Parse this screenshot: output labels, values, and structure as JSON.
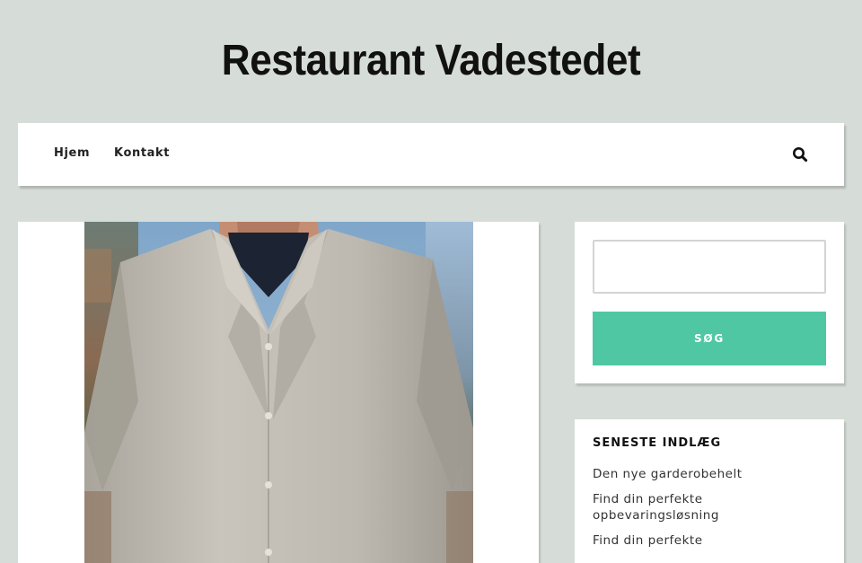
{
  "site": {
    "title": "Restaurant Vadestedet"
  },
  "nav": {
    "items": [
      {
        "label": "Hjem"
      },
      {
        "label": "Kontakt"
      }
    ],
    "search_icon": "search-icon"
  },
  "main": {
    "featured_image": {
      "subject": "man wearing a light grey short-sleeve camp-collar shirt over a navy t-shirt",
      "colors": {
        "sky": "#8fb1d0",
        "shirt": "#c4c0b8",
        "undershirt": "#1c2333",
        "background_left": "#6b5a4c",
        "foliage": "#3f5b3a"
      }
    }
  },
  "sidebar": {
    "search": {
      "value": "",
      "placeholder": "",
      "button_label": "SØG"
    },
    "recent_posts": {
      "title": "SENESTE INDLÆG",
      "items": [
        {
          "label": "Den nye garderobehelt"
        },
        {
          "label": "Find din perfekte opbevaringsløsning"
        },
        {
          "label": "Find din perfekte"
        }
      ]
    }
  },
  "colors": {
    "page_background": "#d6dcd7",
    "accent": "#4fc7a3",
    "text": "#222222"
  }
}
